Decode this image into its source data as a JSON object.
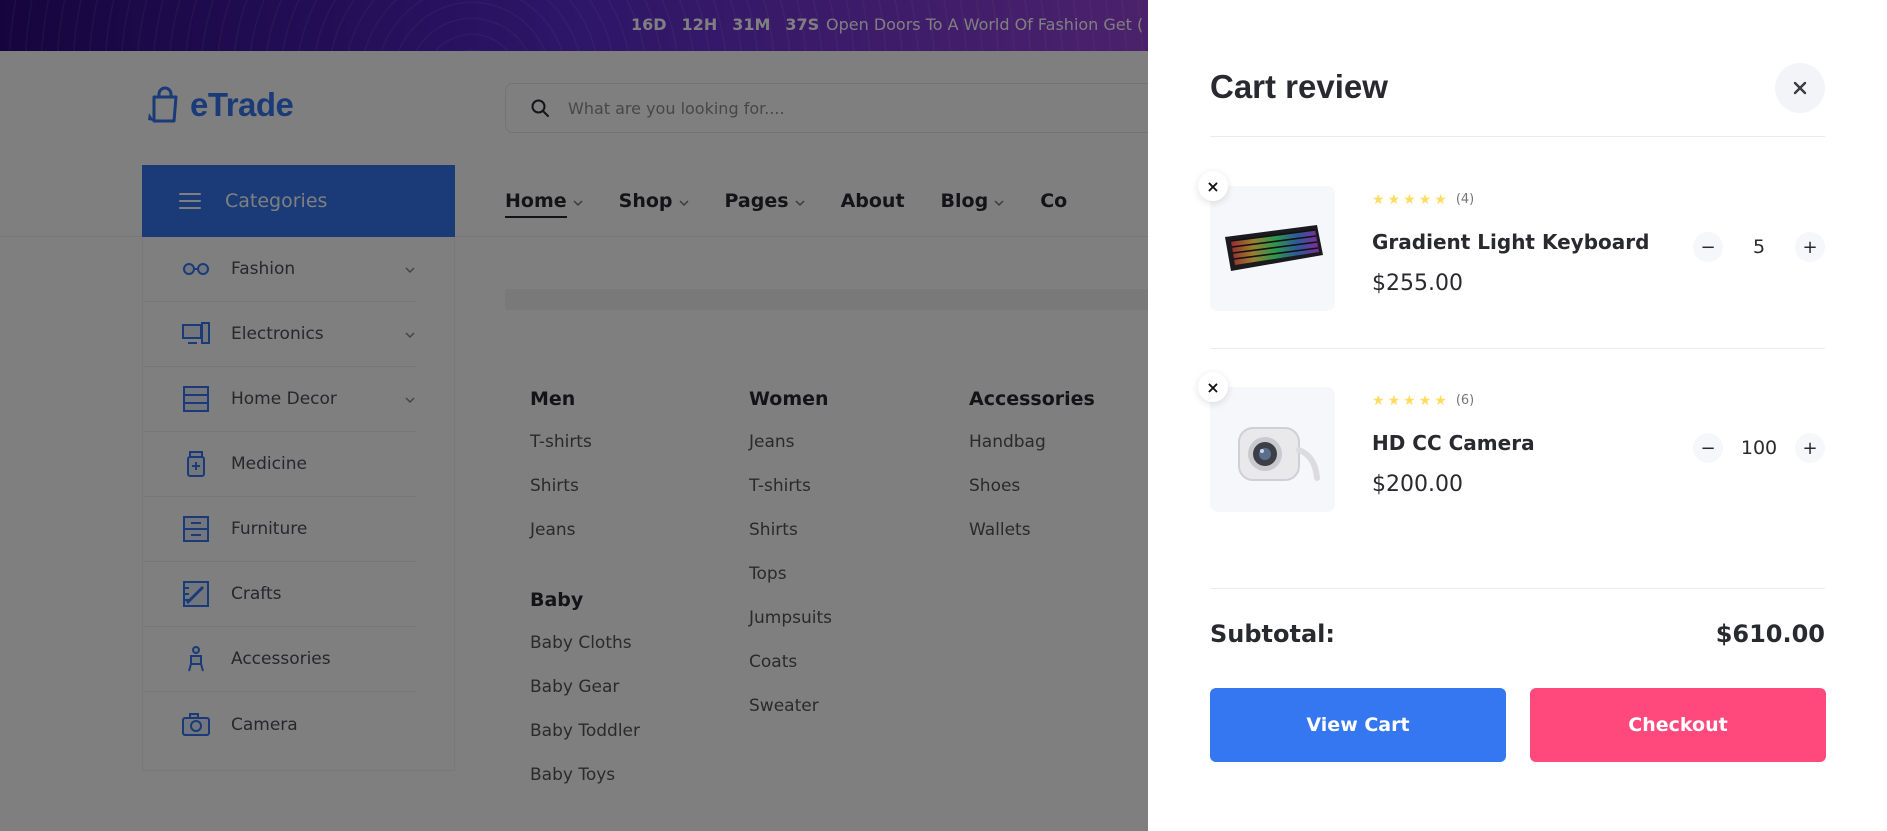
{
  "promo": {
    "countdown": [
      "16D",
      "12H",
      "31M",
      "37S"
    ],
    "message": "Open Doors To A World Of Fashion Get ("
  },
  "header": {
    "brand": "eTrade",
    "search_placeholder": "What are you looking for...."
  },
  "nav": {
    "categories_label": "Categories",
    "menu": [
      {
        "label": "Home",
        "has_dropdown": true,
        "active": true
      },
      {
        "label": "Shop",
        "has_dropdown": true
      },
      {
        "label": "Pages",
        "has_dropdown": true
      },
      {
        "label": "About",
        "has_dropdown": false
      },
      {
        "label": "Blog",
        "has_dropdown": true
      },
      {
        "label": "Co",
        "has_dropdown": false
      }
    ]
  },
  "sidebar": {
    "items": [
      {
        "label": "Fashion",
        "icon": "glasses-icon",
        "has_dropdown": true
      },
      {
        "label": "Electronics",
        "icon": "computer-icon",
        "has_dropdown": true
      },
      {
        "label": "Home Decor",
        "icon": "drawer-icon",
        "has_dropdown": true
      },
      {
        "label": "Medicine",
        "icon": "medicine-bottle-icon",
        "has_dropdown": false
      },
      {
        "label": "Furniture",
        "icon": "cabinet-icon",
        "has_dropdown": false
      },
      {
        "label": "Crafts",
        "icon": "ruler-pencil-icon",
        "has_dropdown": false
      },
      {
        "label": "Accessories",
        "icon": "chair-icon",
        "has_dropdown": false
      },
      {
        "label": "Camera",
        "icon": "camera-icon",
        "has_dropdown": false
      }
    ]
  },
  "mega_menu": {
    "men": {
      "title": "Men",
      "links": [
        "T-shirts",
        "Shirts",
        "Jeans"
      ]
    },
    "baby": {
      "title": "Baby",
      "links": [
        "Baby Cloths",
        "Baby Gear",
        "Baby Toddler",
        "Baby Toys"
      ]
    },
    "women": {
      "title": "Women",
      "links": [
        "Jeans",
        "T-shirts",
        "Shirts",
        "Tops",
        "Jumpsuits",
        "Coats",
        "Sweater"
      ]
    },
    "accessories": {
      "title": "Accessories",
      "links": [
        "Handbag",
        "Shoes",
        "Wallets"
      ]
    }
  },
  "cart": {
    "title": "Cart review",
    "items": [
      {
        "name": "Gradient Light Keyboard",
        "price": "$255.00",
        "rating": 5,
        "reviews": "(4)",
        "quantity": "5",
        "image": "keyboard-image"
      },
      {
        "name": "HD CC Camera",
        "price": "$200.00",
        "rating": 5,
        "reviews": "(6)",
        "quantity": "100",
        "image": "webcam-image"
      }
    ],
    "subtotal_label": "Subtotal:",
    "subtotal_value": "$610.00",
    "view_cart_label": "View Cart",
    "checkout_label": "Checkout",
    "remove_glyph": "×",
    "minus_glyph": "−",
    "plus_glyph": "+",
    "star_glyph": "★"
  },
  "colors": {
    "primary": "#3577f0",
    "checkout": "#ff497c",
    "star": "#ffdc60",
    "text": "#292930"
  }
}
